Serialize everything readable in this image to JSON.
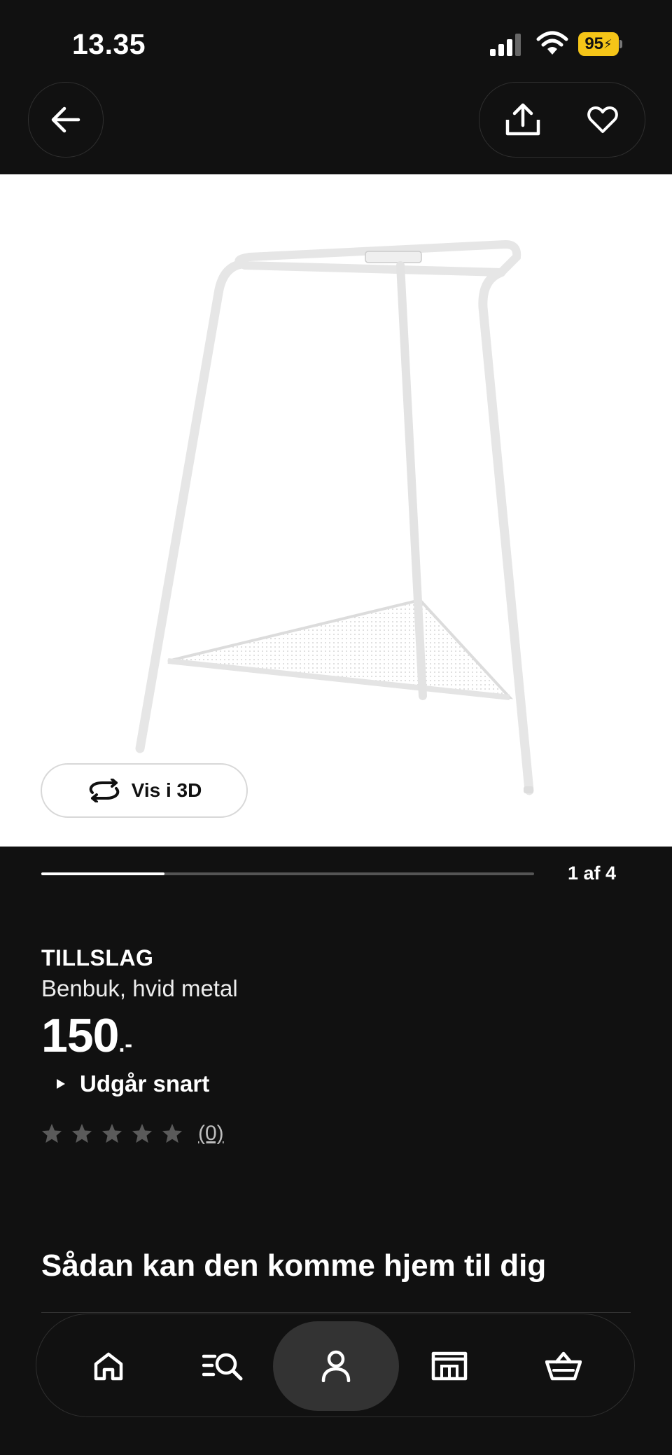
{
  "status_bar": {
    "time": "13.35",
    "battery": "95"
  },
  "product": {
    "name": "TILLSLAG",
    "description": "Benbuk, hvid metal",
    "price": "150",
    "price_suffix": ".-",
    "availability": "Udgår snart",
    "rating_stars_filled": 0,
    "rating_count": "(0)"
  },
  "gallery": {
    "view_3d_label": "Vis i 3D",
    "page_counter": "1 af 4",
    "progress_fraction": 0.25
  },
  "section": {
    "delivery_heading": "Sådan kan den komme hjem til dig"
  },
  "bottom_nav": {
    "items": [
      {
        "name": "home",
        "icon": "home-icon"
      },
      {
        "name": "search",
        "icon": "search-list-icon"
      },
      {
        "name": "profile",
        "icon": "person-icon",
        "active": true
      },
      {
        "name": "store",
        "icon": "store-icon"
      },
      {
        "name": "basket",
        "icon": "basket-icon"
      }
    ]
  },
  "colors": {
    "background": "#111111",
    "battery": "#f5c518",
    "active_nav": "#333333"
  }
}
